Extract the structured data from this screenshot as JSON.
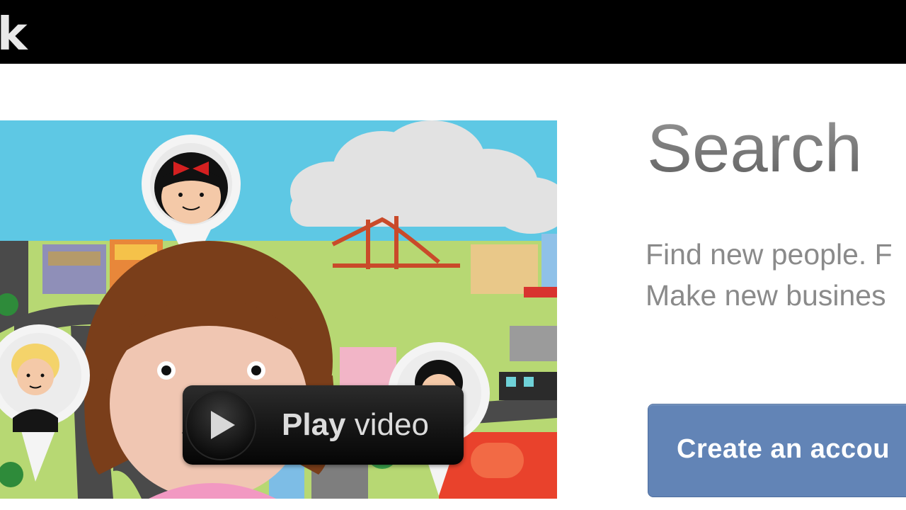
{
  "header": {
    "logo_text": "k"
  },
  "video": {
    "play_label_bold": "Play",
    "play_label_rest": " video"
  },
  "hero": {
    "headline": "Search",
    "subline_1": "Find new people. F",
    "subline_2": "Make new busines"
  },
  "cta": {
    "label": "Create an accou"
  },
  "colors": {
    "top_bar": "#000000",
    "cta_button": "#6284b6",
    "sky": "#5ec8e4"
  }
}
